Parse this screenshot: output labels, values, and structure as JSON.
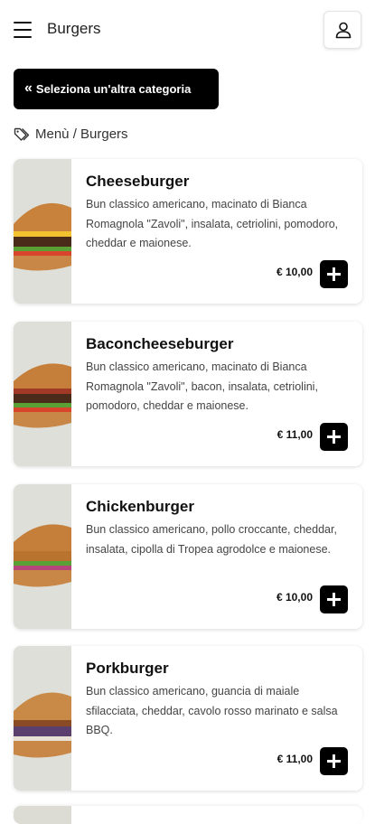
{
  "header": {
    "title": "Burgers",
    "account_icon": "user-icon",
    "menu_icon": "hamburger-menu-icon"
  },
  "back_button": {
    "label": "Seleziona un'altra categoria",
    "icon": "double-chevron-left-icon"
  },
  "breadcrumb": {
    "text": "Menù / Burgers",
    "icon": "tag-icon"
  },
  "products": [
    {
      "name": "Cheeseburger",
      "description": "Bun classico americano, macinato di Bianca Romagnola \"Zavoli\", insalata, cetriolini, pomodoro, cheddar e maionese.",
      "price": "€ 10,00"
    },
    {
      "name": "Baconcheeseburger",
      "description": "Bun classico americano, macinato di Bianca Romagnola \"Zavoli\", bacon, insalata, cetriolini, pomodoro, cheddar e maionese.",
      "price": "€ 11,00"
    },
    {
      "name": "Chickenburger",
      "description": "Bun classico americano, pollo croccante, cheddar, insalata, cipolla di Tropea agrodolce e maionese.",
      "price": "€ 10,00"
    },
    {
      "name": "Porkburger",
      "description": "Bun classico americano, guancia di maiale sfilacciata, cheddar, cavolo rosso marinato e salsa BBQ.",
      "price": "€ 11,00"
    }
  ],
  "colors": {
    "accent": "#000000",
    "background": "#ffffff",
    "text_muted": "#444444"
  }
}
